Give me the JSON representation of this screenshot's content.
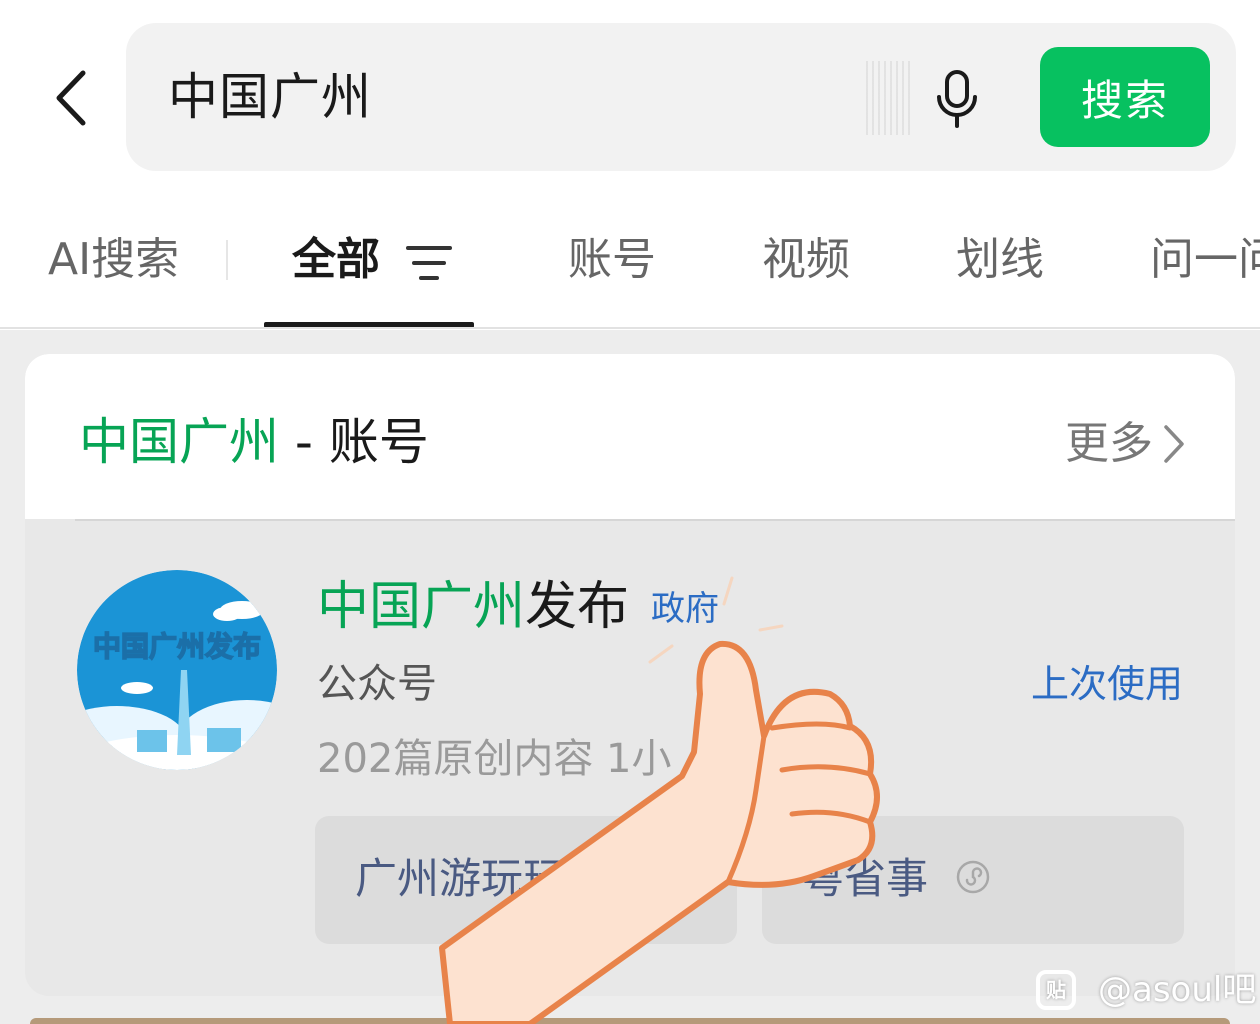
{
  "search": {
    "query": "中国广州",
    "button_label": "搜索"
  },
  "tabs": [
    {
      "label": "AI搜索",
      "active": false
    },
    {
      "label": "全部",
      "active": true
    },
    {
      "label": "账号",
      "active": false
    },
    {
      "label": "视频",
      "active": false
    },
    {
      "label": "划线",
      "active": false
    },
    {
      "label": "问一问",
      "active": false
    }
  ],
  "section": {
    "title_highlight": "中国广州",
    "title_rest": " - 账号",
    "more_label": "更多"
  },
  "account": {
    "name_highlight": "中国广州",
    "name_rest": "发布",
    "badge": "政府",
    "type": "公众号",
    "last_used": "上次使用",
    "meta": "202篇原创内容  1小",
    "avatar_text": "中国广州发布",
    "services": [
      {
        "label": "广州游玩玩"
      },
      {
        "label": "粤省事",
        "icon": "mini-program-icon"
      }
    ]
  },
  "watermark": {
    "logo_text": "贴",
    "text": "@asoul吧"
  },
  "colors": {
    "accent_green": "#07c160",
    "highlight_green": "#07a455",
    "link_blue": "#2b6cc4"
  }
}
